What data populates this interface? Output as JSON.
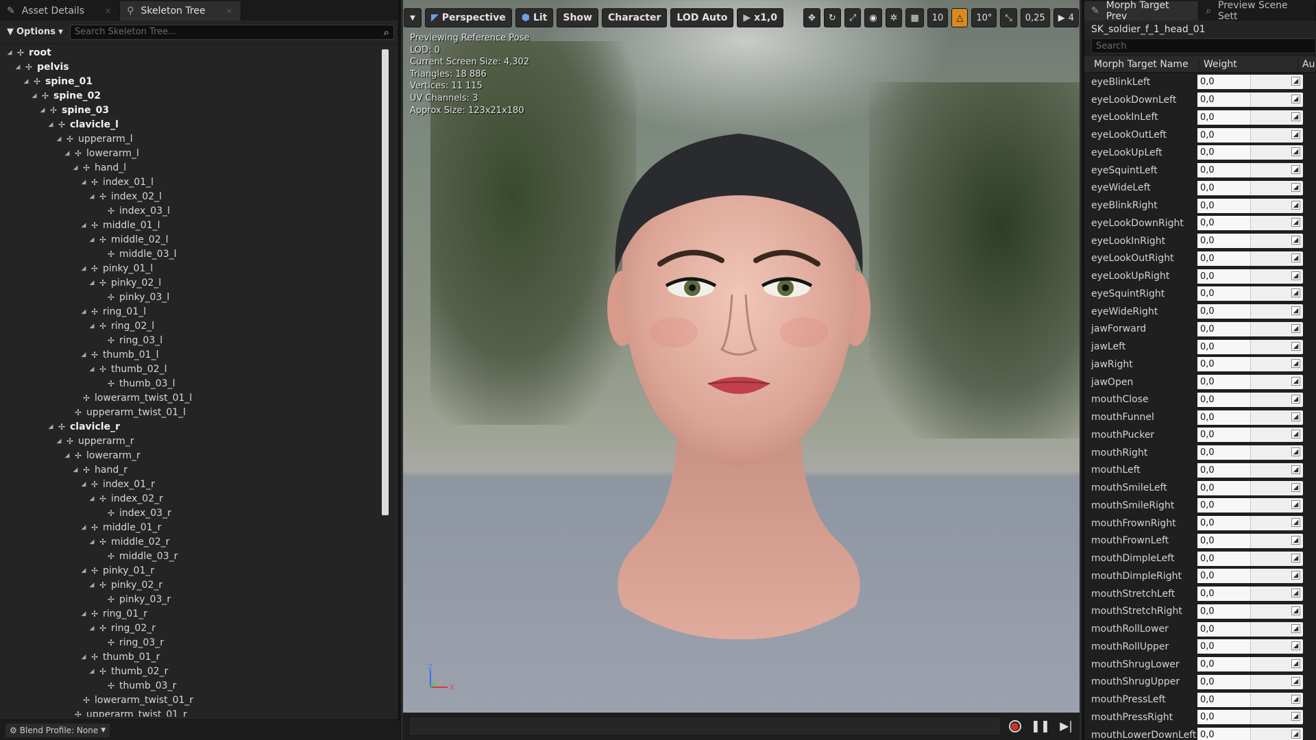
{
  "left_panel": {
    "tabs": [
      {
        "label": "Asset Details"
      },
      {
        "label": "Skeleton Tree"
      }
    ],
    "options_label": "Options",
    "search_placeholder": "Search Skeleton Tree...",
    "blend_profile_label": "Blend Profile: None",
    "tree": [
      {
        "name": "root",
        "depth": 0,
        "bold": true,
        "expanded": true
      },
      {
        "name": "pelvis",
        "depth": 1,
        "bold": true,
        "expanded": true
      },
      {
        "name": "spine_01",
        "depth": 2,
        "bold": true,
        "expanded": true
      },
      {
        "name": "spine_02",
        "depth": 3,
        "bold": true,
        "expanded": true
      },
      {
        "name": "spine_03",
        "depth": 4,
        "bold": true,
        "expanded": true
      },
      {
        "name": "clavicle_l",
        "depth": 5,
        "bold": true,
        "expanded": true
      },
      {
        "name": "upperarm_l",
        "depth": 6,
        "bold": false,
        "expanded": true
      },
      {
        "name": "lowerarm_l",
        "depth": 7,
        "bold": false,
        "expanded": true
      },
      {
        "name": "hand_l",
        "depth": 8,
        "bold": false,
        "expanded": true
      },
      {
        "name": "index_01_l",
        "depth": 9,
        "bold": false,
        "expanded": true
      },
      {
        "name": "index_02_l",
        "depth": 10,
        "bold": false,
        "expanded": true
      },
      {
        "name": "index_03_l",
        "depth": 11,
        "bold": false,
        "expanded": false
      },
      {
        "name": "middle_01_l",
        "depth": 9,
        "bold": false,
        "expanded": true
      },
      {
        "name": "middle_02_l",
        "depth": 10,
        "bold": false,
        "expanded": true
      },
      {
        "name": "middle_03_l",
        "depth": 11,
        "bold": false,
        "expanded": false
      },
      {
        "name": "pinky_01_l",
        "depth": 9,
        "bold": false,
        "expanded": true
      },
      {
        "name": "pinky_02_l",
        "depth": 10,
        "bold": false,
        "expanded": true
      },
      {
        "name": "pinky_03_l",
        "depth": 11,
        "bold": false,
        "expanded": false
      },
      {
        "name": "ring_01_l",
        "depth": 9,
        "bold": false,
        "expanded": true
      },
      {
        "name": "ring_02_l",
        "depth": 10,
        "bold": false,
        "expanded": true
      },
      {
        "name": "ring_03_l",
        "depth": 11,
        "bold": false,
        "expanded": false
      },
      {
        "name": "thumb_01_l",
        "depth": 9,
        "bold": false,
        "expanded": true
      },
      {
        "name": "thumb_02_l",
        "depth": 10,
        "bold": false,
        "expanded": true
      },
      {
        "name": "thumb_03_l",
        "depth": 11,
        "bold": false,
        "expanded": false
      },
      {
        "name": "lowerarm_twist_01_l",
        "depth": 8,
        "bold": false,
        "expanded": false
      },
      {
        "name": "upperarm_twist_01_l",
        "depth": 7,
        "bold": false,
        "expanded": false
      },
      {
        "name": "clavicle_r",
        "depth": 5,
        "bold": true,
        "expanded": true
      },
      {
        "name": "upperarm_r",
        "depth": 6,
        "bold": false,
        "expanded": true
      },
      {
        "name": "lowerarm_r",
        "depth": 7,
        "bold": false,
        "expanded": true
      },
      {
        "name": "hand_r",
        "depth": 8,
        "bold": false,
        "expanded": true
      },
      {
        "name": "index_01_r",
        "depth": 9,
        "bold": false,
        "expanded": true
      },
      {
        "name": "index_02_r",
        "depth": 10,
        "bold": false,
        "expanded": true
      },
      {
        "name": "index_03_r",
        "depth": 11,
        "bold": false,
        "expanded": false
      },
      {
        "name": "middle_01_r",
        "depth": 9,
        "bold": false,
        "expanded": true
      },
      {
        "name": "middle_02_r",
        "depth": 10,
        "bold": false,
        "expanded": true
      },
      {
        "name": "middle_03_r",
        "depth": 11,
        "bold": false,
        "expanded": false
      },
      {
        "name": "pinky_01_r",
        "depth": 9,
        "bold": false,
        "expanded": true
      },
      {
        "name": "pinky_02_r",
        "depth": 10,
        "bold": false,
        "expanded": true
      },
      {
        "name": "pinky_03_r",
        "depth": 11,
        "bold": false,
        "expanded": false
      },
      {
        "name": "ring_01_r",
        "depth": 9,
        "bold": false,
        "expanded": true
      },
      {
        "name": "ring_02_r",
        "depth": 10,
        "bold": false,
        "expanded": true
      },
      {
        "name": "ring_03_r",
        "depth": 11,
        "bold": false,
        "expanded": false
      },
      {
        "name": "thumb_01_r",
        "depth": 9,
        "bold": false,
        "expanded": true
      },
      {
        "name": "thumb_02_r",
        "depth": 10,
        "bold": false,
        "expanded": true
      },
      {
        "name": "thumb_03_r",
        "depth": 11,
        "bold": false,
        "expanded": false
      },
      {
        "name": "lowerarm_twist_01_r",
        "depth": 8,
        "bold": false,
        "expanded": false
      },
      {
        "name": "upperarm_twist_01_r",
        "depth": 7,
        "bold": false,
        "expanded": false
      }
    ]
  },
  "viewport": {
    "toolbar": {
      "perspective": "Perspective",
      "lit": "Lit",
      "show": "Show",
      "character": "Character",
      "lod": "LOD Auto",
      "play_speed": "x1,0",
      "grid_snap": "10",
      "rotation_snap": "10°",
      "scale_snap": "0,25",
      "camera_speed": "4"
    },
    "stats": [
      "Previewing Reference Pose",
      "LOD: 0",
      "Current Screen Size: 4,302",
      "Triangles: 18 886",
      "Vertices: 11 115",
      "UV Channels: 3",
      "Approx Size: 123x21x180"
    ],
    "axes": {
      "z": "Z",
      "x": "X"
    },
    "colors": {
      "record": "#d23030",
      "warning": "#d88a1e"
    }
  },
  "right_panel": {
    "tabs": [
      {
        "label": "Morph Target Prev"
      },
      {
        "label": "Preview Scene Sett"
      }
    ],
    "asset_name": "SK_soldier_f_1_head_01",
    "search_placeholder": "Search",
    "columns": {
      "name": "Morph Target Name",
      "weight": "Weight",
      "auto": "Au"
    },
    "morph_targets": [
      {
        "name": "eyeBlinkLeft",
        "weight": "0,0"
      },
      {
        "name": "eyeLookDownLeft",
        "weight": "0,0"
      },
      {
        "name": "eyeLookInLeft",
        "weight": "0,0"
      },
      {
        "name": "eyeLookOutLeft",
        "weight": "0,0"
      },
      {
        "name": "eyeLookUpLeft",
        "weight": "0,0"
      },
      {
        "name": "eyeSquintLeft",
        "weight": "0,0"
      },
      {
        "name": "eyeWideLeft",
        "weight": "0,0"
      },
      {
        "name": "eyeBlinkRight",
        "weight": "0,0"
      },
      {
        "name": "eyeLookDownRight",
        "weight": "0,0"
      },
      {
        "name": "eyeLookInRight",
        "weight": "0,0"
      },
      {
        "name": "eyeLookOutRight",
        "weight": "0,0"
      },
      {
        "name": "eyeLookUpRight",
        "weight": "0,0"
      },
      {
        "name": "eyeSquintRight",
        "weight": "0,0"
      },
      {
        "name": "eyeWideRight",
        "weight": "0,0"
      },
      {
        "name": "jawForward",
        "weight": "0,0"
      },
      {
        "name": "jawLeft",
        "weight": "0,0"
      },
      {
        "name": "jawRight",
        "weight": "0,0"
      },
      {
        "name": "jawOpen",
        "weight": "0,0"
      },
      {
        "name": "mouthClose",
        "weight": "0,0"
      },
      {
        "name": "mouthFunnel",
        "weight": "0,0"
      },
      {
        "name": "mouthPucker",
        "weight": "0,0"
      },
      {
        "name": "mouthRight",
        "weight": "0,0"
      },
      {
        "name": "mouthLeft",
        "weight": "0,0"
      },
      {
        "name": "mouthSmileLeft",
        "weight": "0,0"
      },
      {
        "name": "mouthSmileRight",
        "weight": "0,0"
      },
      {
        "name": "mouthFrownRight",
        "weight": "0,0"
      },
      {
        "name": "mouthFrownLeft",
        "weight": "0,0"
      },
      {
        "name": "mouthDimpleLeft",
        "weight": "0,0"
      },
      {
        "name": "mouthDimpleRight",
        "weight": "0,0"
      },
      {
        "name": "mouthStretchLeft",
        "weight": "0,0"
      },
      {
        "name": "mouthStretchRight",
        "weight": "0,0"
      },
      {
        "name": "mouthRollLower",
        "weight": "0,0"
      },
      {
        "name": "mouthRollUpper",
        "weight": "0,0"
      },
      {
        "name": "mouthShrugLower",
        "weight": "0,0"
      },
      {
        "name": "mouthShrugUpper",
        "weight": "0,0"
      },
      {
        "name": "mouthPressLeft",
        "weight": "0,0"
      },
      {
        "name": "mouthPressRight",
        "weight": "0,0"
      },
      {
        "name": "mouthLowerDownLeft",
        "weight": "0,0"
      }
    ]
  }
}
